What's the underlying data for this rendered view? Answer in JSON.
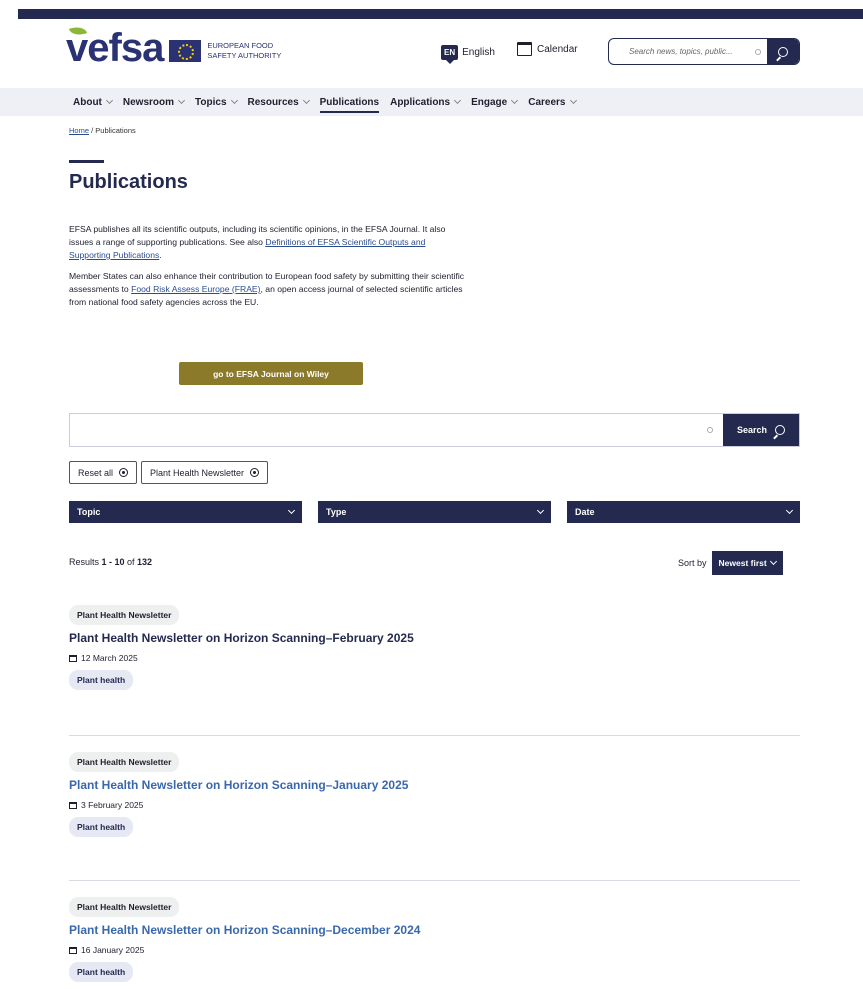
{
  "header": {
    "logo_word": "efsa",
    "logo_text_line1": "EUROPEAN FOOD",
    "logo_text_line2": "SAFETY AUTHORITY",
    "lang_code": "EN",
    "lang_label": "English",
    "calendar_label": "Calendar",
    "search_placeholder": "Search news, topics, public..."
  },
  "nav": {
    "items": [
      {
        "label": "About",
        "dropdown": true
      },
      {
        "label": "Newsroom",
        "dropdown": true
      },
      {
        "label": "Topics",
        "dropdown": true
      },
      {
        "label": "Resources",
        "dropdown": true
      },
      {
        "label": "Publications",
        "dropdown": false
      },
      {
        "label": "Applications",
        "dropdown": true
      },
      {
        "label": "Engage",
        "dropdown": true
      },
      {
        "label": "Careers",
        "dropdown": true
      }
    ]
  },
  "breadcrumb": {
    "home": "Home",
    "separator": "/",
    "current": "Publications"
  },
  "page": {
    "title": "Publications",
    "intro1_a": "EFSA publishes all its scientific outputs, including its scientific opinions, in the EFSA Journal. It also issues a range of supporting publications. See also ",
    "intro1_link": "Definitions of EFSA Scientific Outputs and Supporting Publications",
    "intro1_b": ".",
    "intro2_a": "Member States can also enhance their contribution to European food safety by submitting their scientific assessments to ",
    "intro2_link": "Food Risk Assess Europe (FRAE)",
    "intro2_b": ", an open access journal of selected scientific articles from national food safety agencies across the EU.",
    "wiley_button": "go to EFSA Journal on Wiley"
  },
  "search": {
    "value": "",
    "button_label": "Search"
  },
  "chips": {
    "reset": "Reset all",
    "active_filter": "Plant Health Newsletter"
  },
  "filters": {
    "topic": "Topic",
    "type": "Type",
    "date": "Date"
  },
  "results": {
    "prefix": "Results ",
    "range": "1 - 10",
    "of": " of ",
    "total": "132",
    "sort_label": "Sort by",
    "sort_value": "Newest first"
  },
  "items": [
    {
      "type": "Plant Health Newsletter",
      "title": "Plant Health Newsletter on Horizon Scanning–February 2025",
      "date": "12 March 2025",
      "topic": "Plant health"
    },
    {
      "type": "Plant Health Newsletter",
      "title": "Plant Health Newsletter on Horizon Scanning–January 2025",
      "date": "3 February 2025",
      "topic": "Plant health"
    },
    {
      "type": "Plant Health Newsletter",
      "title": "Plant Health Newsletter on Horizon Scanning–December 2024",
      "date": "16 January 2025",
      "topic": "Plant health"
    }
  ]
}
